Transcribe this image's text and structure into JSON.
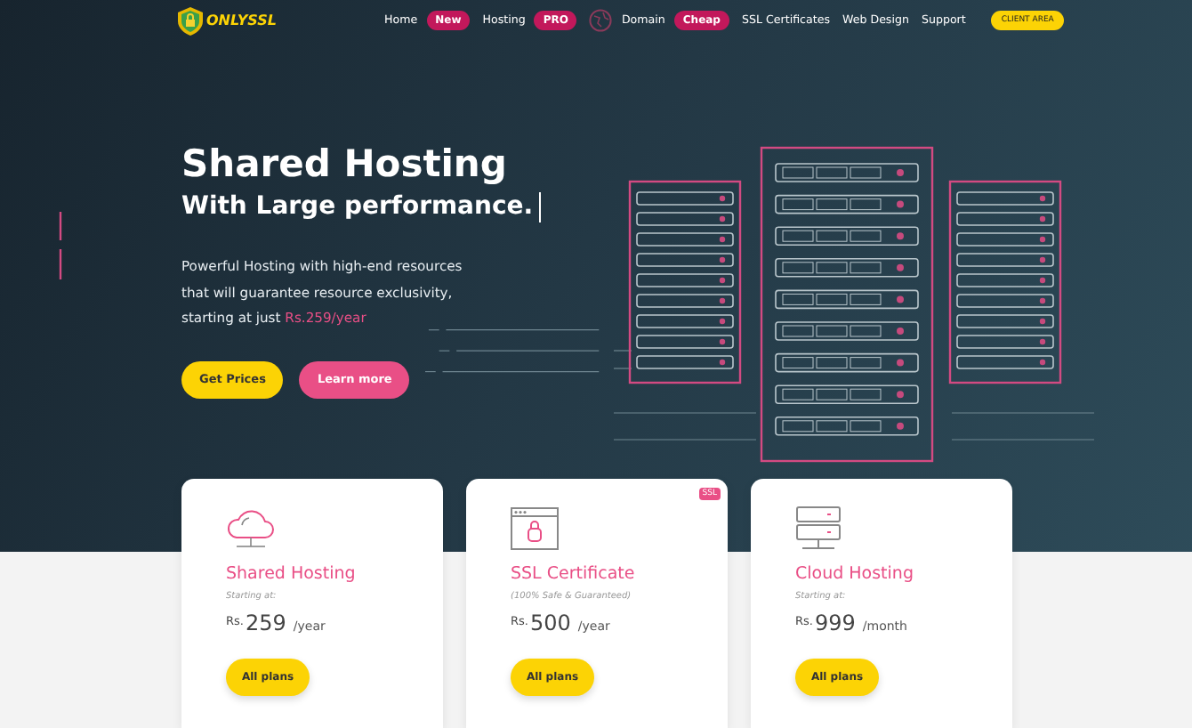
{
  "logo": {
    "text": "ONLYSSL"
  },
  "nav": [
    {
      "label": "Home",
      "badge": "New",
      "globe": false
    },
    {
      "label": "Hosting",
      "badge": "PRO",
      "globe": false
    },
    {
      "label": "Domain",
      "badge": "Cheap",
      "globe": true
    },
    {
      "label": "SSL Certificates",
      "globe": false
    },
    {
      "label": "Web Design",
      "globe": false
    },
    {
      "label": "Support",
      "globe": false
    }
  ],
  "client_button": "CLIENT AREA",
  "hero": {
    "title": "Shared Hosting",
    "subtitle": "With Large performance.",
    "caret": true,
    "description": "Powerful Hosting with high-end resources that will guarantee resource exclusivity, starting at just ",
    "price": "Rs.259/year",
    "buttons": [
      {
        "label": "Get Prices",
        "kind": "primary"
      },
      {
        "label": "Learn more",
        "kind": "secondary"
      }
    ]
  },
  "cards": [
    {
      "kind": "cloud",
      "title": "Shared Hosting",
      "subtitle": "Starting at:",
      "currency": "Rs.",
      "amount": "259",
      "period": "/year",
      "button": "All plans"
    },
    {
      "kind": "lock",
      "title": "SSL Certificate",
      "subtitle": "(100% Safe & Guaranteed)",
      "currency": "Rs.",
      "amount": "500",
      "period": "/year",
      "button": "All plans",
      "badge": "SSL"
    },
    {
      "kind": "server",
      "title": "Cloud Hosting",
      "subtitle": "Starting at:",
      "currency": "Rs.",
      "amount": "999",
      "period": "/month",
      "button": "All plans"
    }
  ]
}
